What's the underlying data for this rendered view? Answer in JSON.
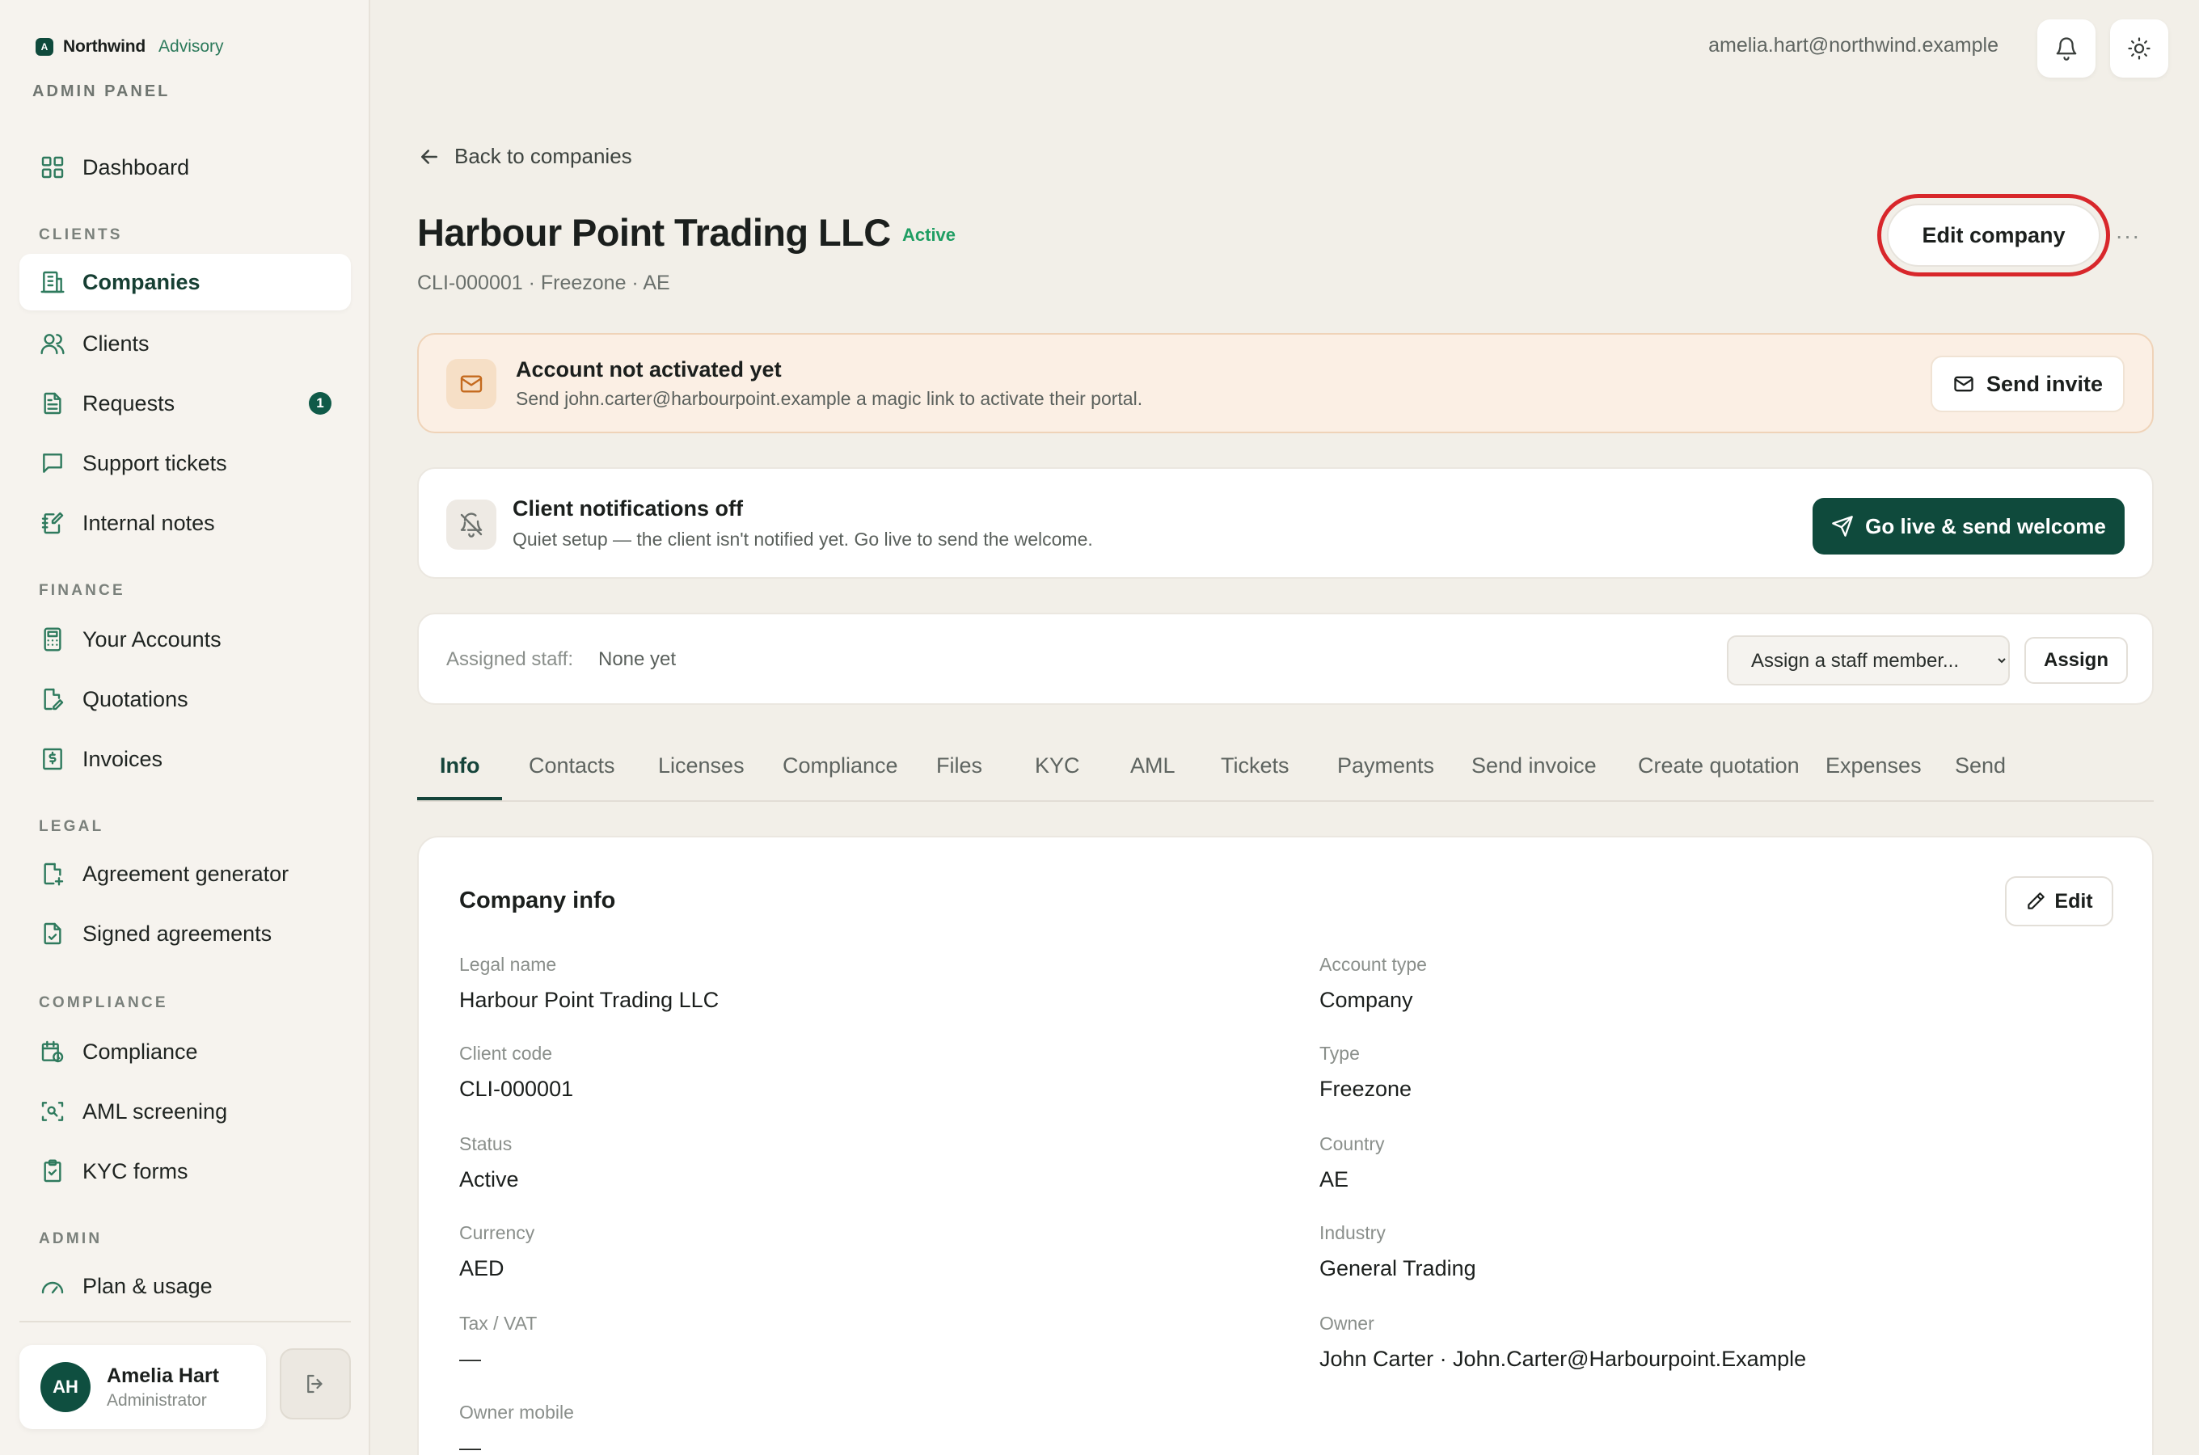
{
  "brand": {
    "mark": "A",
    "name": "Northwind",
    "sub": "Advisory",
    "panel_label": "ADMIN PANEL"
  },
  "nav": {
    "dashboard": "Dashboard",
    "sections": {
      "clients": "CLIENTS",
      "finance": "FINANCE",
      "legal": "LEGAL",
      "compliance": "COMPLIANCE",
      "admin": "ADMIN"
    },
    "companies": "Companies",
    "clients": "Clients",
    "requests": "Requests",
    "requests_badge": "1",
    "support_tickets": "Support tickets",
    "internal_notes": "Internal notes",
    "your_accounts": "Your Accounts",
    "quotations": "Quotations",
    "invoices": "Invoices",
    "agreement_generator": "Agreement generator",
    "signed_agreements": "Signed agreements",
    "compliance": "Compliance",
    "aml_screening": "AML screening",
    "kyc_forms": "KYC forms",
    "plan_usage": "Plan & usage"
  },
  "user": {
    "initials": "AH",
    "name": "Amelia Hart",
    "role": "Administrator",
    "email": "amelia.hart@northwind.example"
  },
  "page": {
    "back_label": "Back to companies",
    "title": "Harbour Point Trading LLC",
    "status": "Active",
    "subtitle": "CLI-000001 · Freezone · AE",
    "edit_company_label": "Edit company",
    "more_label": "···"
  },
  "activation_alert": {
    "title": "Account not activated yet",
    "text": "Send john.carter@harbourpoint.example a magic link to activate their portal.",
    "button": "Send invite"
  },
  "notifications_alert": {
    "title": "Client notifications off",
    "text": "Quiet setup — the client isn't notified yet. Go live to send the welcome.",
    "button": "Go live & send welcome"
  },
  "staff": {
    "label": "Assigned staff:",
    "value": "None yet",
    "select_value": "Assign a staff member...",
    "assign_button": "Assign"
  },
  "tabs": [
    "Info",
    "Contacts",
    "Licenses",
    "Compliance",
    "Files",
    "KYC",
    "AML",
    "Tickets",
    "Payments",
    "Send invoice",
    "Create quotation",
    "Expenses",
    "Send"
  ],
  "company_info": {
    "title": "Company info",
    "edit_label": "Edit",
    "fields": [
      {
        "label": "Legal name",
        "value": "Harbour Point Trading LLC"
      },
      {
        "label": "Account type",
        "value": "Company"
      },
      {
        "label": "Client code",
        "value": "CLI-000001"
      },
      {
        "label": "Type",
        "value": "Freezone"
      },
      {
        "label": "Status",
        "value": "Active"
      },
      {
        "label": "Country",
        "value": "AE"
      },
      {
        "label": "Currency",
        "value": "AED"
      },
      {
        "label": "Industry",
        "value": "General Trading"
      },
      {
        "label": "Tax / VAT",
        "value": "—"
      },
      {
        "label": "Owner",
        "value": "John Carter · John.Carter@Harbourpoint.Example"
      },
      {
        "label": "Owner mobile",
        "value": "—"
      }
    ]
  },
  "colors": {
    "accent": "#0f4a3c",
    "active_status": "#1f9e63",
    "highlight_ring": "#d8272b",
    "alert_bg": "#fbefe4"
  }
}
